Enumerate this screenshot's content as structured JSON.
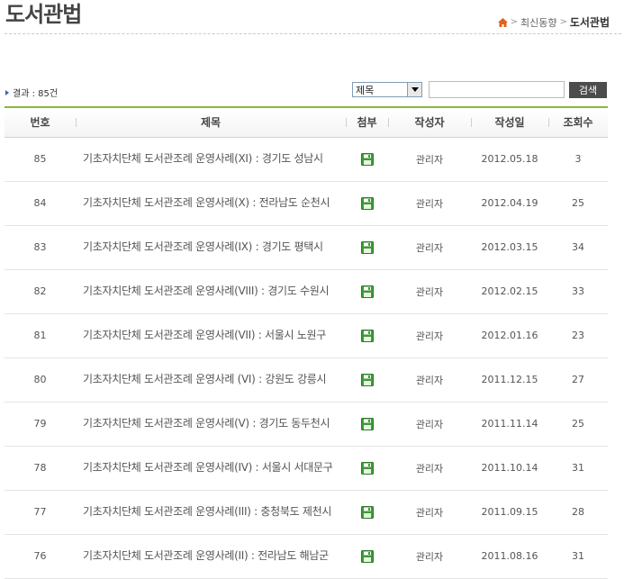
{
  "header": {
    "title": "도서관법",
    "breadcrumb": [
      "최신동향",
      "도서관법"
    ]
  },
  "search": {
    "result_label": "결과 : 85건",
    "select_value": "제목",
    "input_value": "",
    "button_label": "검색"
  },
  "table": {
    "columns": [
      "번호",
      "제목",
      "첨부",
      "작성자",
      "작성일",
      "조회수"
    ],
    "rows": [
      {
        "no": "85",
        "title": "기초자치단체 도서관조례 운영사례(XI) : 경기도 성남시",
        "author": "관리자",
        "date": "2012.05.18",
        "views": "3"
      },
      {
        "no": "84",
        "title": "기초자치단체 도서관조례 운영사례(X) : 전라남도 순천시",
        "author": "관리자",
        "date": "2012.04.19",
        "views": "25"
      },
      {
        "no": "83",
        "title": "기초자치단체 도서관조례 운영사례(IX) : 경기도 평택시",
        "author": "관리자",
        "date": "2012.03.15",
        "views": "34"
      },
      {
        "no": "82",
        "title": "기초자치단체 도서관조례 운영사례(VIII) : 경기도 수원시",
        "author": "관리자",
        "date": "2012.02.15",
        "views": "33"
      },
      {
        "no": "81",
        "title": "기초자치단체 도서관조례 운영사례(VII) : 서울시 노원구",
        "author": "관리자",
        "date": "2012.01.16",
        "views": "23"
      },
      {
        "no": "80",
        "title": "기초자치단체 도서관조례 운영사례 (VI) : 강원도 강릉시",
        "author": "관리자",
        "date": "2011.12.15",
        "views": "27"
      },
      {
        "no": "79",
        "title": "기초자치단체 도서관조례 운영사례(V) : 경기도 동두천시",
        "author": "관리자",
        "date": "2011.11.14",
        "views": "25"
      },
      {
        "no": "78",
        "title": "기초자치단체 도서관조례 운영사례(IV) : 서울시 서대문구",
        "author": "관리자",
        "date": "2011.10.14",
        "views": "31"
      },
      {
        "no": "77",
        "title": "기초자치단체 도서관조례 운영사례(III) : 충청북도 제천시",
        "author": "관리자",
        "date": "2011.09.15",
        "views": "28"
      },
      {
        "no": "76",
        "title": "기초자치단체 도서관조례 운영사례(II) : 전라남도 해남군",
        "author": "관리자",
        "date": "2011.08.16",
        "views": "31"
      }
    ]
  },
  "colors": {
    "accent_green": "#8ab836",
    "home_icon": "#e2601c",
    "attach_icon": "#3f9b38"
  }
}
